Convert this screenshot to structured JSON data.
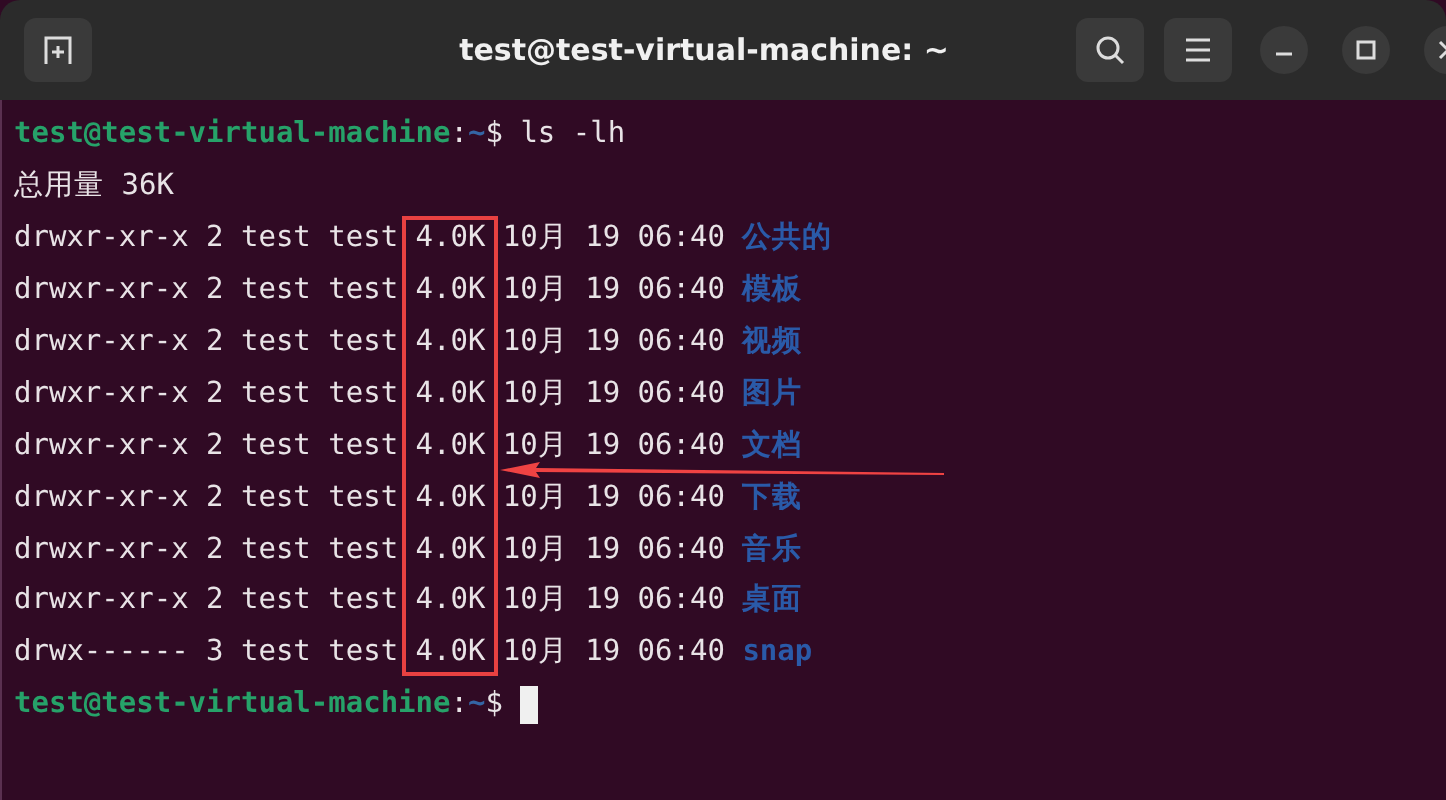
{
  "window": {
    "title": "test@test-virtual-machine: ~"
  },
  "terminal": {
    "lines": [
      {
        "kind": "prompt",
        "user_host": "test@test-virtual-machine",
        "separator": ":",
        "path": "~",
        "symbol": "$",
        "command": "ls -lh"
      },
      {
        "kind": "output",
        "text": "总用量 36K"
      },
      {
        "kind": "entry",
        "info": "drwxr-xr-x 2 test test 4.0K 10月 19 06:40",
        "name": "公共的"
      },
      {
        "kind": "entry",
        "info": "drwxr-xr-x 2 test test 4.0K 10月 19 06:40",
        "name": "模板"
      },
      {
        "kind": "entry",
        "info": "drwxr-xr-x 2 test test 4.0K 10月 19 06:40",
        "name": "视频"
      },
      {
        "kind": "entry",
        "info": "drwxr-xr-x 2 test test 4.0K 10月 19 06:40",
        "name": "图片"
      },
      {
        "kind": "entry",
        "info": "drwxr-xr-x 2 test test 4.0K 10月 19 06:40",
        "name": "文档"
      },
      {
        "kind": "entry",
        "info": "drwxr-xr-x 2 test test 4.0K 10月 19 06:40",
        "name": "下载"
      },
      {
        "kind": "entry",
        "info": "drwxr-xr-x 2 test test 4.0K 10月 19 06:40",
        "name": "音乐"
      },
      {
        "kind": "entry",
        "info": "drwxr-xr-x 2 test test 4.0K 10月 19 06:40",
        "name": "桌面"
      },
      {
        "kind": "entry",
        "info": "drwx------ 3 test test 4.0K 10月 19 06:40",
        "name": "snap"
      },
      {
        "kind": "prompt",
        "user_host": "test@test-virtual-machine",
        "separator": ":",
        "path": "~",
        "symbol": "$",
        "cursor": true
      }
    ]
  }
}
